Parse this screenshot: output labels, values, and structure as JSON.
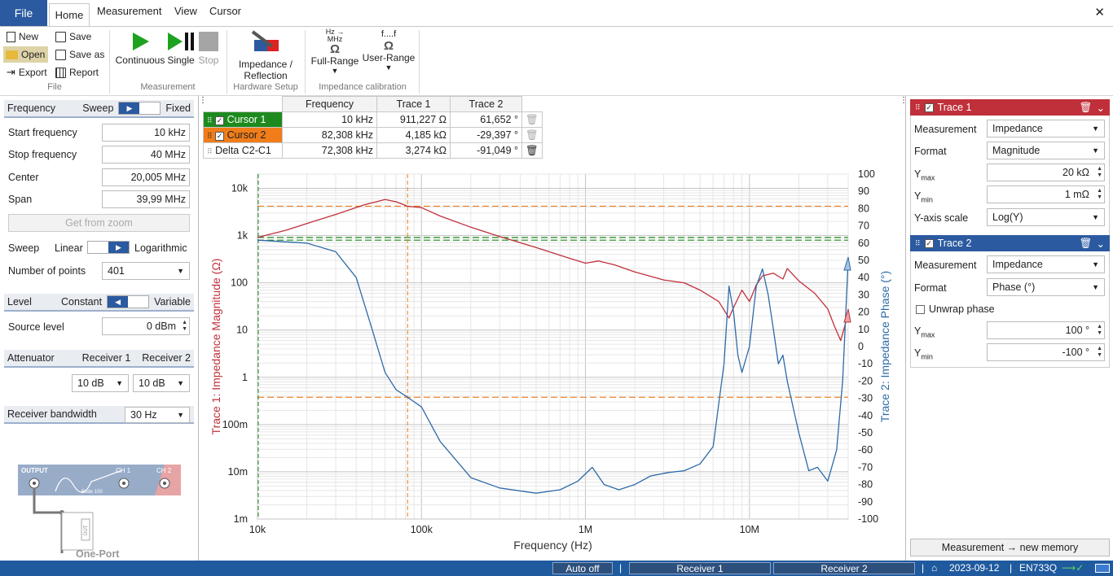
{
  "menu": {
    "file": "File",
    "tabs": [
      "Home",
      "Measurement",
      "View",
      "Cursor"
    ]
  },
  "ribbon": {
    "file_group": {
      "new": "New",
      "open": "Open",
      "export": "Export",
      "save": "Save",
      "save_as": "Save as",
      "report": "Report",
      "label": "File"
    },
    "measurement_group": {
      "continuous": "Continuous",
      "single": "Single",
      "stop": "Stop",
      "label": "Measurement"
    },
    "hardware_group": {
      "impedance": "Impedance /",
      "reflection": "Reflection",
      "label": "Hardware Setup"
    },
    "calibration_group": {
      "full_top": "Hz →",
      "full_top2": "MHz",
      "full_symbol": "Ω",
      "full_range": "Full-Range",
      "user_top": "f....f",
      "user_symbol": "Ω",
      "user_range": "User-Range",
      "label": "Impedance calibration"
    }
  },
  "left": {
    "frequency": "Frequency",
    "sweep": "Sweep",
    "fixed": "Fixed",
    "start_label": "Start frequency",
    "start_value": "10 kHz",
    "stop_label": "Stop frequency",
    "stop_value": "40 MHz",
    "center_label": "Center",
    "center_value": "20,005 MHz",
    "span_label": "Span",
    "span_value": "39,99 MHz",
    "get_from_zoom": "Get from zoom",
    "sweep_label": "Sweep",
    "linear": "Linear",
    "logarithmic": "Logarithmic",
    "points_label": "Number of points",
    "points_value": "401",
    "level": "Level",
    "constant": "Constant",
    "variable": "Variable",
    "source_label": "Source level",
    "source_value": "0 dBm",
    "attenuator": "Attenuator",
    "receiver1": "Receiver 1",
    "receiver2": "Receiver 2",
    "att1": "10 dB",
    "att2": "10 dB",
    "bandwidth_label": "Receiver bandwidth",
    "bandwidth_value": "30 Hz",
    "diagram": {
      "output": "OUTPUT",
      "ch1": "CH 1",
      "ch2": "CH 2",
      "device": "Bode 100",
      "dut": "DUT",
      "caption": "One-Port"
    }
  },
  "cursors": {
    "headers": [
      "Frequency",
      "Trace 1",
      "Trace 2"
    ],
    "rows": [
      {
        "name": "Cursor 1",
        "freq": "10 kHz",
        "t1": "911,227 Ω",
        "t2": "61,652 °"
      },
      {
        "name": "Cursor 2",
        "freq": "82,308 kHz",
        "t1": "4,185 kΩ",
        "t2": "-29,397 °"
      },
      {
        "name": "Delta C2-C1",
        "freq": "72,308 kHz",
        "t1": "3,274 kΩ",
        "t2": "-91,049 °"
      }
    ]
  },
  "right": {
    "trace1": {
      "title": "Trace 1",
      "measurement_label": "Measurement",
      "measurement": "Impedance",
      "format_label": "Format",
      "format": "Magnitude",
      "ymax_label": "Y",
      "ymax_sub": "max",
      "ymax": "20 kΩ",
      "ymin_label": "Y",
      "ymin_sub": "min",
      "ymin": "1 mΩ",
      "scale_label": "Y-axis scale",
      "scale": "Log(Y)"
    },
    "trace2": {
      "title": "Trace 2",
      "measurement_label": "Measurement",
      "measurement": "Impedance",
      "format_label": "Format",
      "format": "Phase (°)",
      "unwrap": "Unwrap phase",
      "ymax_label": "Y",
      "ymax_sub": "max",
      "ymax": "100 °",
      "ymin_label": "Y",
      "ymin_sub": "min",
      "ymin": "-100 °"
    },
    "memory_button": "Measurement → new memory"
  },
  "status": {
    "auto": "Auto off",
    "sep": "|",
    "receiver1": "Receiver 1",
    "receiver2": "Receiver 2",
    "date": "2023-09-12",
    "device": "EN733Q"
  },
  "colors": {
    "accent": "#2b5aa0",
    "trace1": "#c0303a",
    "trace2": "#2d6aa8",
    "cursor1": "#1e8a1e",
    "cursor2": "#f07d1a"
  },
  "chart_data": {
    "type": "line",
    "xlabel": "Frequency (Hz)",
    "ylabel": "Trace 1: Impedance Magnitude (Ω)",
    "y2label": "Trace 2: Impedance Phase (°)",
    "x_scale": "log",
    "xlim": [
      10000,
      40000000
    ],
    "y_scale": "log",
    "ylim": [
      0.001,
      20000
    ],
    "y2lim": [
      -100,
      100
    ],
    "x_ticks": [
      {
        "v": 10000,
        "label": "10k"
      },
      {
        "v": 100000,
        "label": "100k"
      },
      {
        "v": 1000000,
        "label": "1M"
      },
      {
        "v": 10000000,
        "label": "10M"
      }
    ],
    "y_ticks": [
      {
        "v": 10000,
        "label": "10k"
      },
      {
        "v": 1000,
        "label": "1k"
      },
      {
        "v": 100,
        "label": "100"
      },
      {
        "v": 10,
        "label": "10"
      },
      {
        "v": 1,
        "label": "1"
      },
      {
        "v": 0.1,
        "label": "100m"
      },
      {
        "v": 0.01,
        "label": "10m"
      },
      {
        "v": 0.001,
        "label": "1m"
      }
    ],
    "y2_ticks": [
      100,
      90,
      80,
      70,
      60,
      50,
      40,
      30,
      20,
      10,
      0,
      -10,
      -20,
      -30,
      -40,
      -50,
      -60,
      -70,
      -80,
      -90,
      -100
    ],
    "grid": true,
    "cursors": [
      {
        "x": 10000
      },
      {
        "x": 82308
      }
    ],
    "series": [
      {
        "axis": "left",
        "color": "#c0303a",
        "x": [
          10000,
          15000,
          20000,
          30000,
          45000,
          60000,
          70000,
          82308,
          100000,
          130000,
          200000,
          300000,
          500000,
          800000,
          1000000,
          1200000,
          1500000,
          2000000,
          3000000,
          4000000,
          5000000,
          6500000,
          7500000,
          8000000,
          9000000,
          10000000,
          11000000,
          12000000,
          14000000,
          16000000,
          17000000,
          20000000,
          25000000,
          30000000,
          33000000,
          36000000,
          40000000
        ],
        "y": [
          911,
          1300,
          1800,
          2800,
          4500,
          5800,
          5200,
          4185,
          3900,
          2600,
          1500,
          950,
          560,
          330,
          260,
          290,
          240,
          170,
          115,
          100,
          70,
          40,
          18,
          30,
          70,
          40,
          90,
          140,
          160,
          120,
          200,
          110,
          60,
          28,
          12,
          6,
          22
        ]
      },
      {
        "axis": "right",
        "color": "#2d6aa8",
        "x": [
          10000,
          20000,
          30000,
          40000,
          50000,
          60000,
          70000,
          82308,
          100000,
          130000,
          200000,
          300000,
          500000,
          700000,
          900000,
          1100000,
          1300000,
          1600000,
          2000000,
          2500000,
          3200000,
          4000000,
          5000000,
          6000000,
          7000000,
          7500000,
          8000000,
          8500000,
          9000000,
          10000000,
          11000000,
          12000000,
          13000000,
          14000000,
          15000000,
          16000000,
          17000000,
          20000000,
          23000000,
          26000000,
          30000000,
          34000000,
          37000000,
          40000000
        ],
        "y": [
          61.7,
          60,
          55,
          40,
          10,
          -15,
          -25,
          -29.4,
          -35,
          -55,
          -76,
          -82,
          -85,
          -83,
          -78,
          -70,
          -80,
          -83,
          -80,
          -75,
          -73,
          -72,
          -68,
          -58,
          -10,
          35,
          20,
          -5,
          -15,
          0,
          35,
          45,
          30,
          10,
          -10,
          -5,
          -20,
          -50,
          -72,
          -70,
          -78,
          -60,
          -20,
          50
        ]
      }
    ]
  }
}
